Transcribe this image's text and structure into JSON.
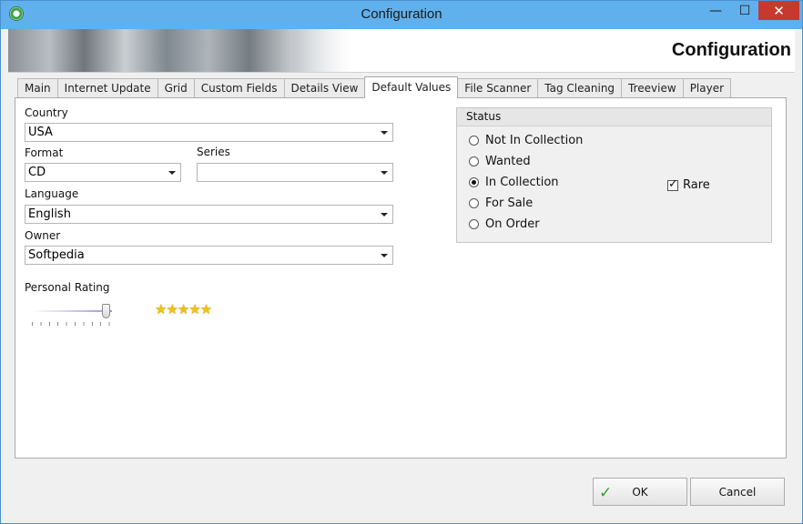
{
  "window": {
    "title": "Configuration",
    "min_glyph": "—",
    "max_glyph": "☐",
    "close_glyph": "✕"
  },
  "banner": {
    "title": "Configuration"
  },
  "tabs": [
    {
      "label": "Main"
    },
    {
      "label": "Internet Update"
    },
    {
      "label": "Grid"
    },
    {
      "label": "Custom Fields"
    },
    {
      "label": "Details View"
    },
    {
      "label": "Default Values",
      "active": true
    },
    {
      "label": "File Scanner"
    },
    {
      "label": "Tag Cleaning"
    },
    {
      "label": "Treeview"
    },
    {
      "label": "Player"
    }
  ],
  "form": {
    "country": {
      "label": "Country",
      "value": "USA"
    },
    "format": {
      "label": "Format",
      "value": "CD"
    },
    "series": {
      "label": "Series",
      "value": ""
    },
    "language": {
      "label": "Language",
      "value": "English"
    },
    "owner": {
      "label": "Owner",
      "value": "Softpedia"
    },
    "rating": {
      "label": "Personal Rating",
      "stars": "★★★★★",
      "level_fraction": 1.0
    }
  },
  "status": {
    "title": "Status",
    "options": [
      {
        "label": "Not In Collection",
        "selected": false
      },
      {
        "label": "Wanted",
        "selected": false
      },
      {
        "label": "In Collection",
        "selected": true
      },
      {
        "label": "For Sale",
        "selected": false
      },
      {
        "label": "On Order",
        "selected": false
      }
    ],
    "rare": {
      "label": "Rare",
      "checked": true
    }
  },
  "buttons": {
    "ok": "OK",
    "cancel": "Cancel"
  },
  "icons": {
    "app": "config-gear-icon",
    "ok": "check-icon"
  },
  "colors": {
    "titlebar": "#5fb0ec",
    "close": "#c7392f",
    "stars": "#f4c20d",
    "ok_check": "#33a12f"
  }
}
